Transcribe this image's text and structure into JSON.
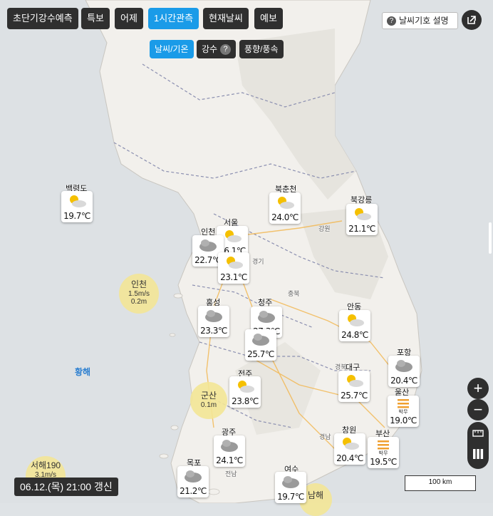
{
  "top_tabs": [
    {
      "label": "초단기강수예측",
      "active": false
    },
    {
      "label": "특보",
      "active": false
    },
    {
      "label": "어제",
      "active": false
    },
    {
      "label": "1시간관측",
      "active": true
    },
    {
      "label": "현재날씨",
      "active": false
    },
    {
      "label": "예보",
      "active": false
    }
  ],
  "legend_button": {
    "icon": "question-icon",
    "label": "날씨기호 설명"
  },
  "external_link_icon": "external-link-icon",
  "sub_tabs": [
    {
      "label": "날씨/기온",
      "active": true
    },
    {
      "label": "강수",
      "active": false,
      "has_help": true
    },
    {
      "label": "풍향/풍속",
      "active": false
    }
  ],
  "stations": [
    {
      "name": "백령도",
      "temp": "19.7℃",
      "icon": "sun-cloud-icon"
    },
    {
      "name": "북춘천",
      "temp": "24.0℃",
      "icon": "sun-cloud-icon"
    },
    {
      "name": "북강릉",
      "temp": "21.1℃",
      "icon": "sun-cloud-icon"
    },
    {
      "name": "서울",
      "temp": "26.1℃",
      "icon": "sun-cloud-icon"
    },
    {
      "name": "인천",
      "temp": "22.7℃",
      "icon": "cloud-icon"
    },
    {
      "name": "",
      "temp": "23.1℃",
      "icon": "sun-cloud-icon"
    },
    {
      "name": "홍성",
      "temp": "23.3℃",
      "icon": "cloud-icon"
    },
    {
      "name": "청주",
      "temp": "27.3℃",
      "icon": "cloud-icon"
    },
    {
      "name": "",
      "temp": "25.7℃",
      "icon": "cloud-icon"
    },
    {
      "name": "안동",
      "temp": "24.8℃",
      "icon": "sun-cloud-icon"
    },
    {
      "name": "포항",
      "temp": "20.4℃",
      "icon": "cloud-icon"
    },
    {
      "name": "대구",
      "temp": "25.7℃",
      "icon": "sun-cloud-icon"
    },
    {
      "name": "울산",
      "temp": "19.0℃",
      "icon": "fog-icon",
      "sub": "박무"
    },
    {
      "name": "전주",
      "temp": "23.8℃",
      "icon": "sun-cloud-icon"
    },
    {
      "name": "광주",
      "temp": "24.1℃",
      "icon": "cloud-icon"
    },
    {
      "name": "창원",
      "temp": "20.4℃",
      "icon": "sun-cloud-icon"
    },
    {
      "name": "부산",
      "temp": "19.5℃",
      "icon": "fog-icon",
      "sub": "박무"
    },
    {
      "name": "목포",
      "temp": "21.2℃",
      "icon": "cloud-icon"
    },
    {
      "name": "여수",
      "temp": "19.7℃",
      "icon": "cloud-icon"
    }
  ],
  "wind_markers": [
    {
      "name": "인천",
      "speed": "1.5m/s",
      "wave": "0.2m"
    },
    {
      "name": "군산",
      "speed": "",
      "wave": "0.1m"
    },
    {
      "name": "서해190",
      "speed": "3.1m/s",
      "wave": ""
    },
    {
      "name": "남해",
      "speed": "",
      "wave": ""
    }
  ],
  "sea_labels": [
    "황해"
  ],
  "map_labels": [
    "강원",
    "경기",
    "충북",
    "경북",
    "경남",
    "전남"
  ],
  "update_text": "06.12.(목) 21:00 갱신",
  "scale_label": "100 km",
  "zoom": {
    "in": "+",
    "out": "−"
  },
  "colors": {
    "accent": "#1a9be8",
    "dark": "#2f2f2f",
    "wind_circle": "#f3e596",
    "sea_label": "#2c7fd0"
  }
}
